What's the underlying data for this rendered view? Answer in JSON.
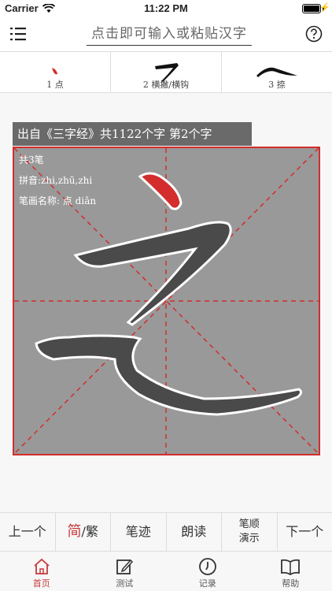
{
  "status": {
    "carrier": "Carrier",
    "time": "11:22 PM"
  },
  "nav": {
    "search_placeholder": "点击即可输入或粘贴汉字"
  },
  "stroke_tabs": [
    {
      "label": "1 点"
    },
    {
      "label": "2 横撇/横钩"
    },
    {
      "label": "3 捺"
    }
  ],
  "source": {
    "text": "出自《三字经》共1122个字 第2个字"
  },
  "character_info": {
    "strokes": "共3笔",
    "pinyin": "拼音:zhi,zhū,zhi",
    "stroke_name": "笔画名称: 点 diǎn"
  },
  "toolbar": {
    "prev": "上一个",
    "simp": "简",
    "sep": "/",
    "trad": "繁",
    "trace": "笔迹",
    "read": "朗读",
    "order_demo_1": "笔顺",
    "order_demo_2": "演示",
    "next": "下一个"
  },
  "tabs": [
    {
      "label": "首页"
    },
    {
      "label": "测试"
    },
    {
      "label": "记录"
    },
    {
      "label": "帮助"
    }
  ],
  "colors": {
    "accent": "#d32d2d",
    "grid_bg": "#999999",
    "stroke_fill": "#4a4a4a"
  }
}
